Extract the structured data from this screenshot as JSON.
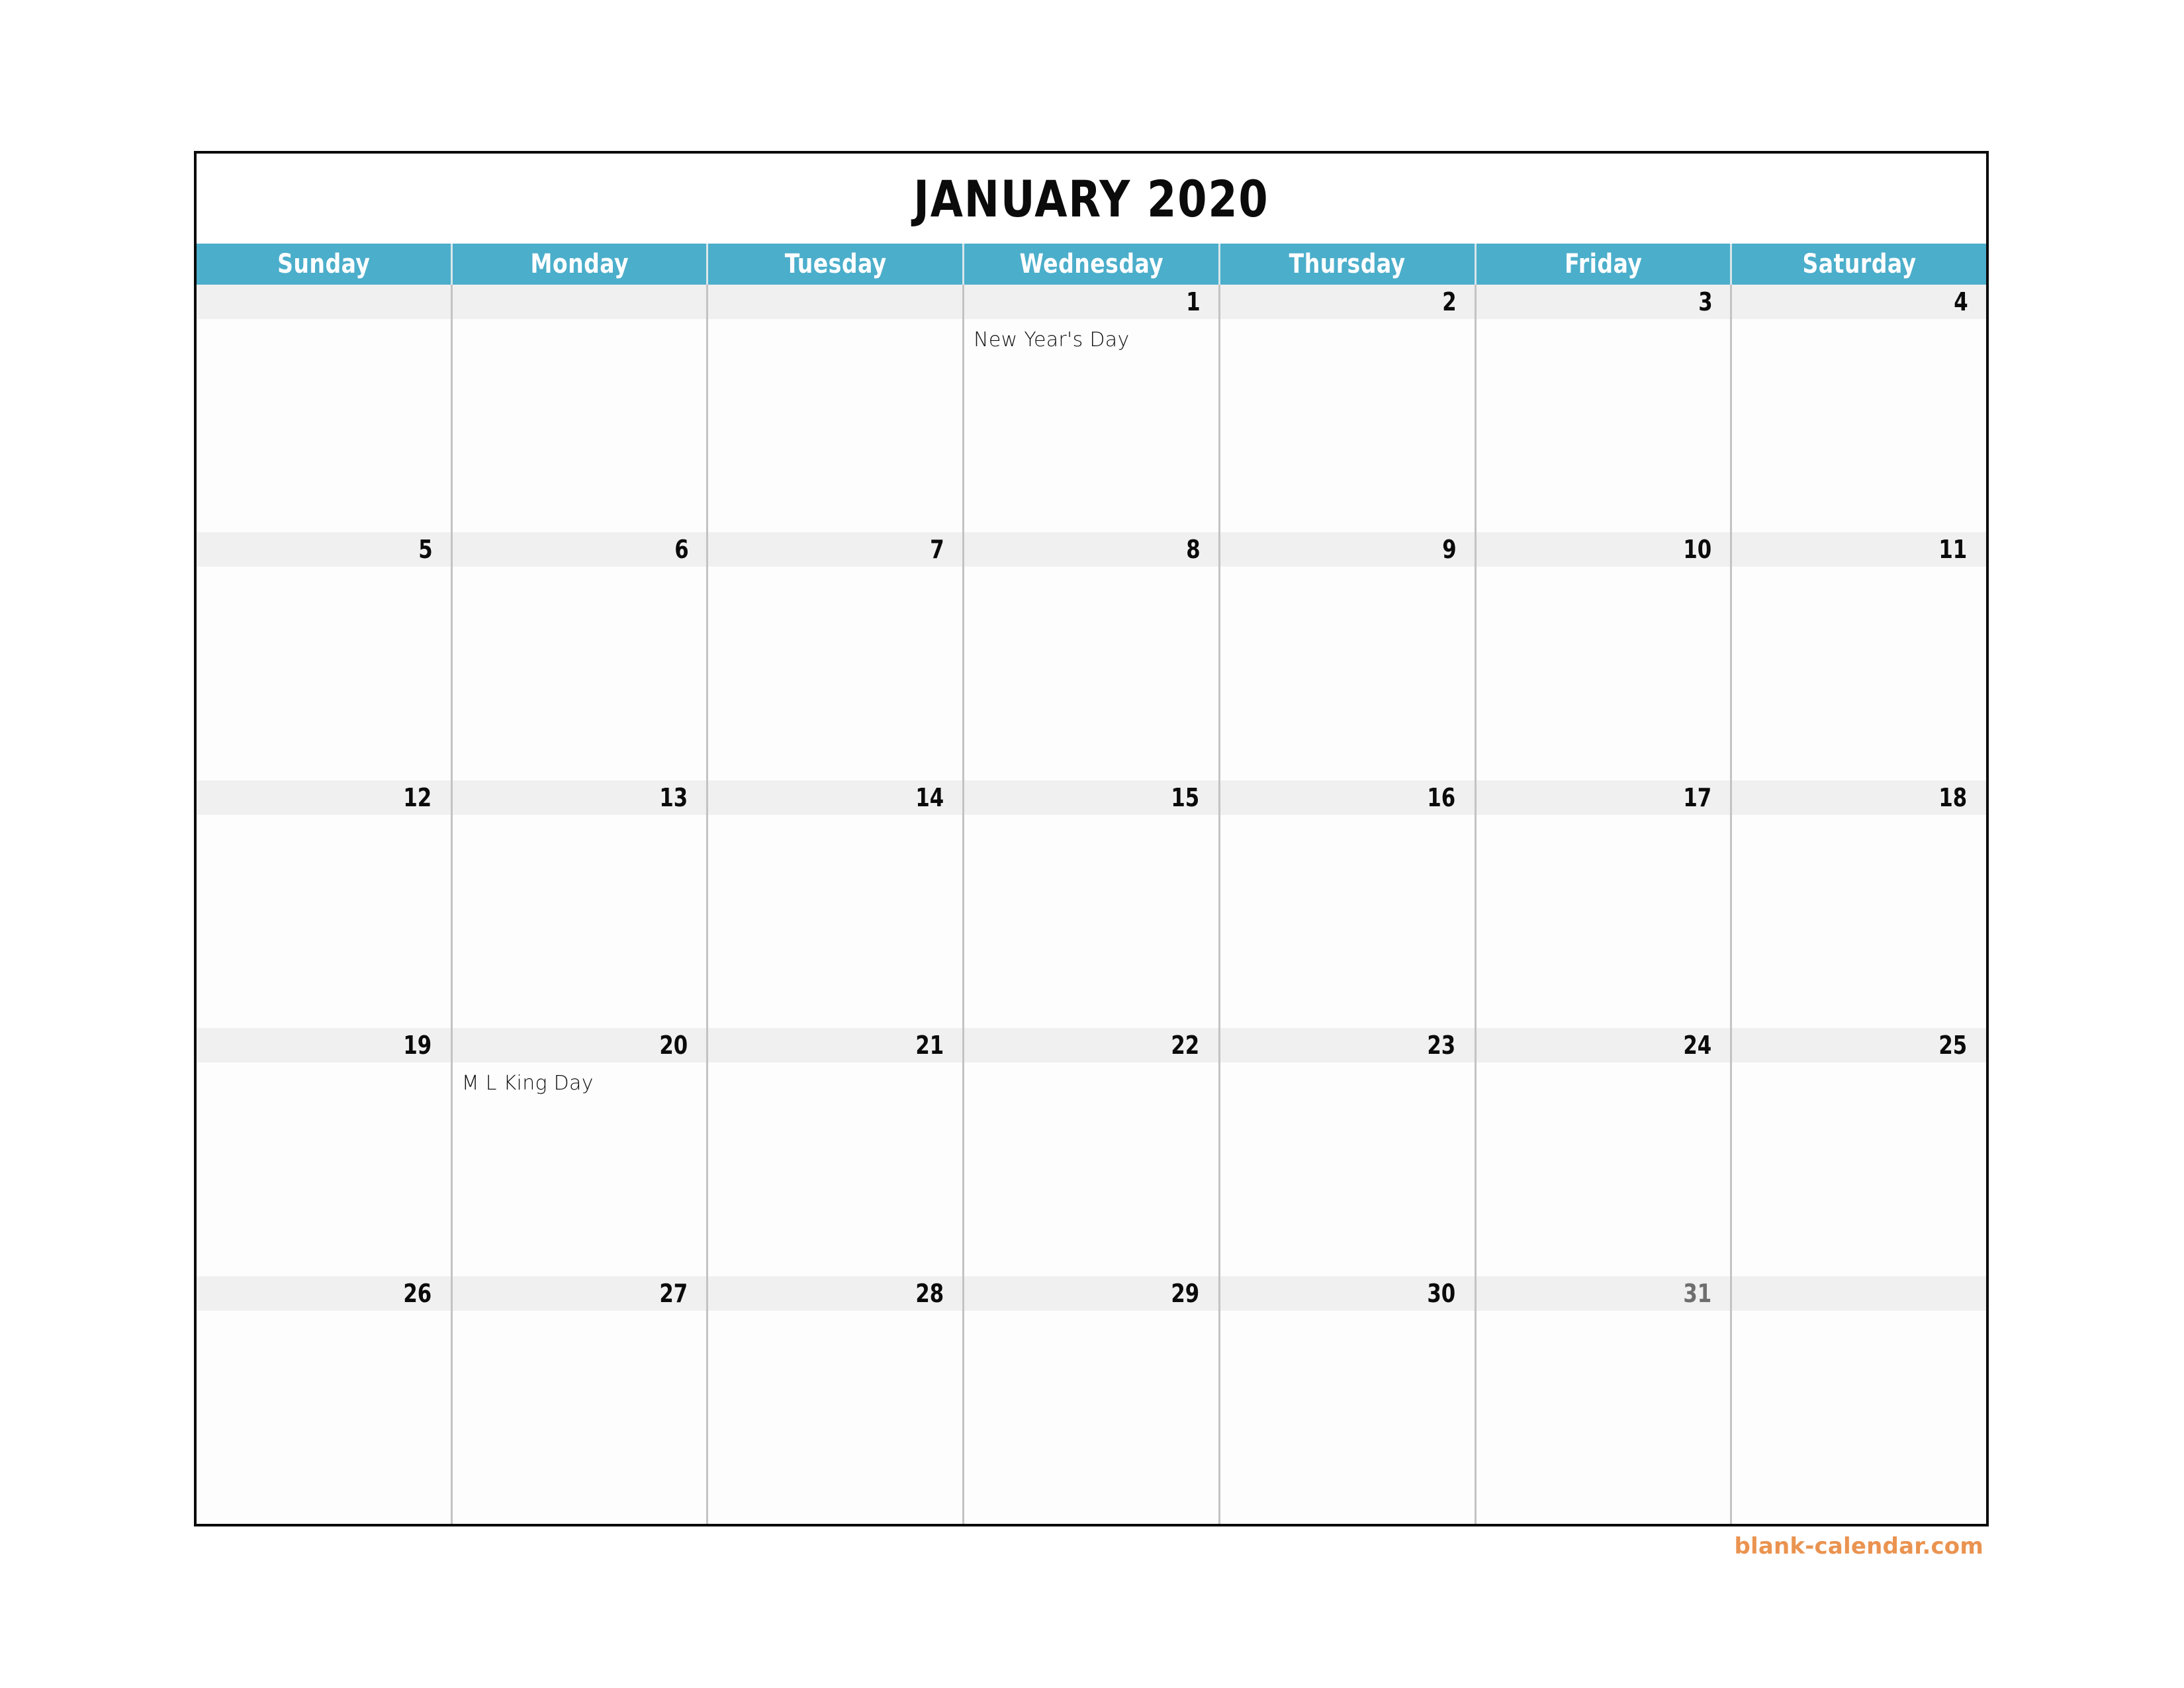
{
  "title": "JANUARY 2020",
  "colors": {
    "header_background": "#4baecb",
    "header_text": "#ffffff",
    "date_band": "#f0f0f0",
    "cell_background": "#fdfdfd",
    "grid_line": "#c3c3c3",
    "outer_border": "#0a0a0a",
    "date_text": "#0b0b0b",
    "date_text_muted": "#6e6e6e",
    "watermark": "#ea9350"
  },
  "weekdays": [
    "Sunday",
    "Monday",
    "Tuesday",
    "Wednesday",
    "Thursday",
    "Friday",
    "Saturday"
  ],
  "weeks": [
    [
      {
        "date": "",
        "event": "",
        "muted": false
      },
      {
        "date": "",
        "event": "",
        "muted": false
      },
      {
        "date": "",
        "event": "",
        "muted": false
      },
      {
        "date": "1",
        "event": "New Year's Day",
        "muted": false
      },
      {
        "date": "2",
        "event": "",
        "muted": false
      },
      {
        "date": "3",
        "event": "",
        "muted": false
      },
      {
        "date": "4",
        "event": "",
        "muted": false
      }
    ],
    [
      {
        "date": "5",
        "event": "",
        "muted": false
      },
      {
        "date": "6",
        "event": "",
        "muted": false
      },
      {
        "date": "7",
        "event": "",
        "muted": false
      },
      {
        "date": "8",
        "event": "",
        "muted": false
      },
      {
        "date": "9",
        "event": "",
        "muted": false
      },
      {
        "date": "10",
        "event": "",
        "muted": false
      },
      {
        "date": "11",
        "event": "",
        "muted": false
      }
    ],
    [
      {
        "date": "12",
        "event": "",
        "muted": false
      },
      {
        "date": "13",
        "event": "",
        "muted": false
      },
      {
        "date": "14",
        "event": "",
        "muted": false
      },
      {
        "date": "15",
        "event": "",
        "muted": false
      },
      {
        "date": "16",
        "event": "",
        "muted": false
      },
      {
        "date": "17",
        "event": "",
        "muted": false
      },
      {
        "date": "18",
        "event": "",
        "muted": false
      }
    ],
    [
      {
        "date": "19",
        "event": "",
        "muted": false
      },
      {
        "date": "20",
        "event": "M L King Day",
        "muted": false
      },
      {
        "date": "21",
        "event": "",
        "muted": false
      },
      {
        "date": "22",
        "event": "",
        "muted": false
      },
      {
        "date": "23",
        "event": "",
        "muted": false
      },
      {
        "date": "24",
        "event": "",
        "muted": false
      },
      {
        "date": "25",
        "event": "",
        "muted": false
      }
    ],
    [
      {
        "date": "26",
        "event": "",
        "muted": false
      },
      {
        "date": "27",
        "event": "",
        "muted": false
      },
      {
        "date": "28",
        "event": "",
        "muted": false
      },
      {
        "date": "29",
        "event": "",
        "muted": false
      },
      {
        "date": "30",
        "event": "",
        "muted": false
      },
      {
        "date": "31",
        "event": "",
        "muted": true
      },
      {
        "date": "",
        "event": "",
        "muted": false
      }
    ]
  ],
  "watermark": "blank-calendar.com"
}
